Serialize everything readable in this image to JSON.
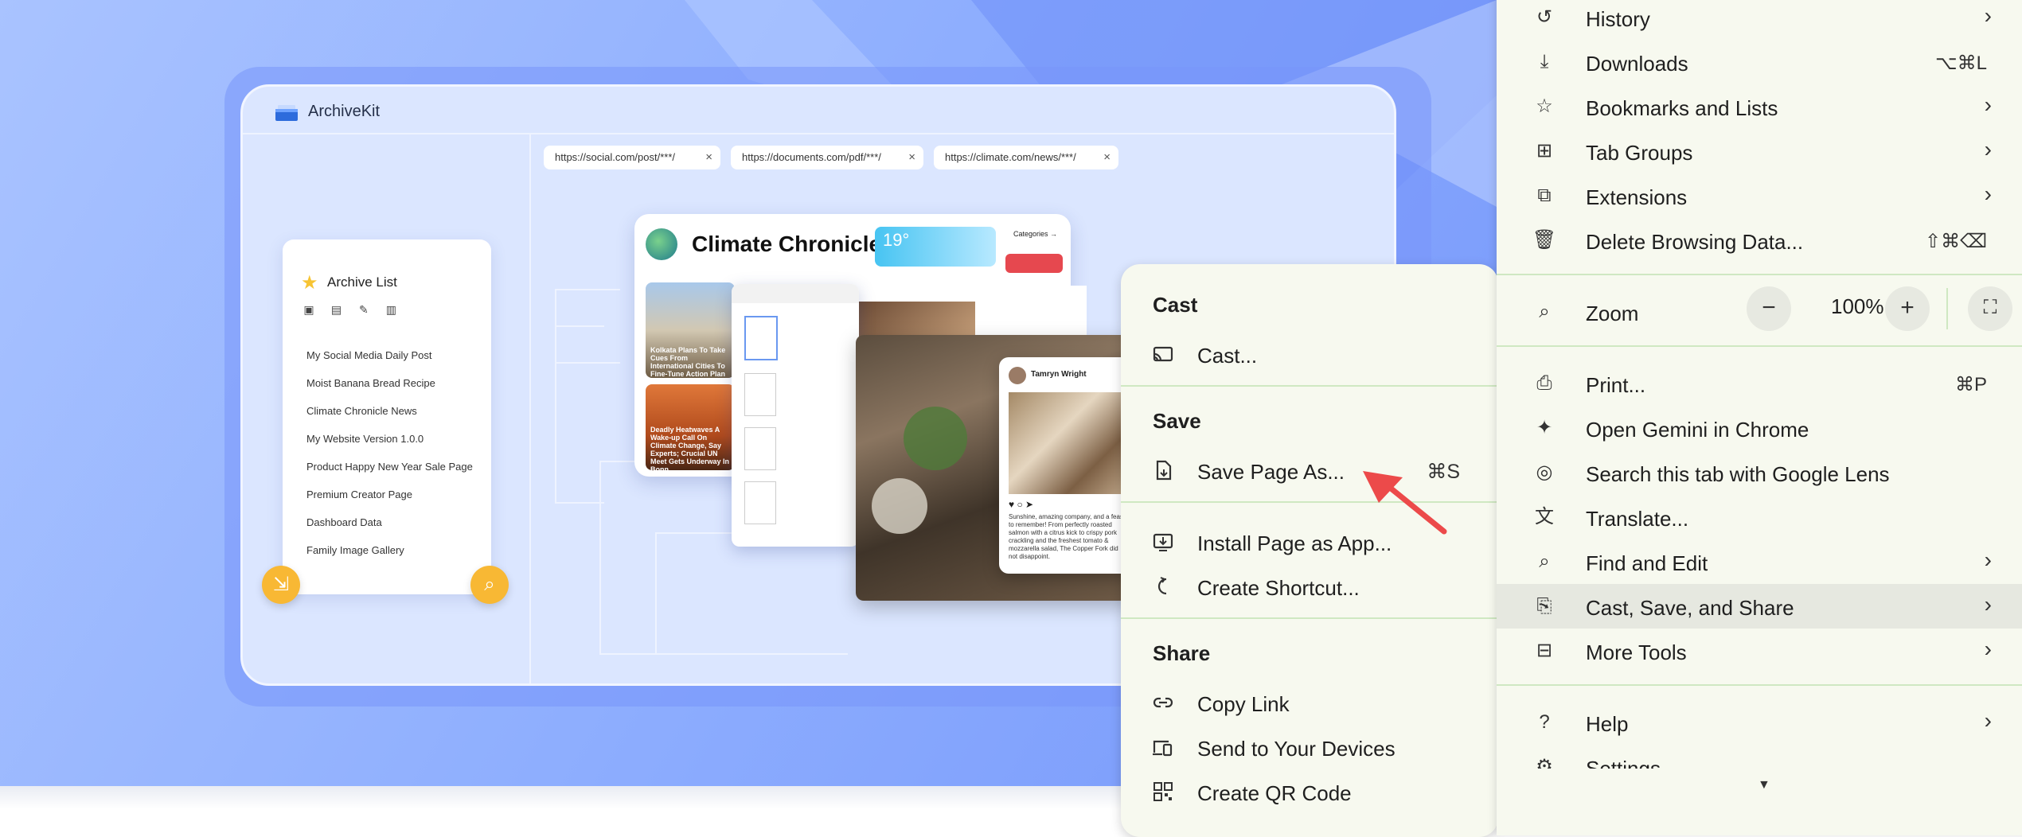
{
  "promo": {
    "app_name": "ArchiveKit",
    "tabs": [
      {
        "url": "https://social.com/post/***/",
        "close": "×"
      },
      {
        "url": "https://documents.com/pdf/***/",
        "close": "×"
      },
      {
        "url": "https://climate.com/news/***/",
        "close": "×"
      }
    ],
    "archive": {
      "title": "Archive List",
      "items": [
        "My Social Media Daily Post",
        "Moist Banana Bread Recipe",
        "Climate Chronicle News",
        "My Website Version 1.0.0",
        "Product Happy New Year Sale Page",
        "Premium Creator Page",
        "Dashboard Data",
        "Family Image Gallery"
      ]
    },
    "climate": {
      "title": "Climate Chronicle",
      "temp": "19°",
      "categories": "Categories →",
      "caption1": "Kolkata Plans To Take Cues From International Cities To Fine-Tune Action Plan And Fight Warm-Up",
      "caption2": "Deadly Heatwaves A Wake-up Call On Climate Change, Say Experts; Crucial UN Meet Gets Underway In Bonn"
    },
    "post": {
      "author": "Tamryn Wright",
      "text": "Sunshine, amazing company, and a feast to remember! From perfectly roasted salmon with a citrus kick to crispy pork crackling and the freshest tomato & mozzarella salad, The Copper Fork did not disappoint."
    }
  },
  "submenu": {
    "sections": {
      "cast": "Cast",
      "save": "Save",
      "share": "Share"
    },
    "items": {
      "cast": {
        "icon": "cast-icon",
        "label": "Cast..."
      },
      "save_page_as": {
        "icon": "save-page-icon",
        "label": "Save Page As...",
        "shortcut": "⌘S"
      },
      "install_app": {
        "icon": "install-app-icon",
        "label": "Install Page as App..."
      },
      "create_shortcut": {
        "icon": "create-shortcut-icon",
        "label": "Create Shortcut..."
      },
      "copy_link": {
        "icon": "link-icon",
        "label": "Copy Link"
      },
      "send_devices": {
        "icon": "send-devices-icon",
        "label": "Send to Your Devices"
      },
      "qr_code": {
        "icon": "qr-code-icon",
        "label": "Create QR Code"
      }
    }
  },
  "mainmenu": {
    "items": {
      "history": {
        "label": "History"
      },
      "downloads": {
        "label": "Downloads",
        "shortcut": "⌥⌘L"
      },
      "bookmarks": {
        "label": "Bookmarks and Lists"
      },
      "tab_groups": {
        "label": "Tab Groups"
      },
      "extensions": {
        "label": "Extensions"
      },
      "delete_data": {
        "label": "Delete Browsing Data...",
        "shortcut": "⇧⌘⌫"
      },
      "zoom": {
        "label": "Zoom",
        "value": "100%",
        "minus": "−",
        "plus": "+"
      },
      "print": {
        "label": "Print...",
        "shortcut": "⌘P"
      },
      "gemini": {
        "label": "Open Gemini in Chrome"
      },
      "lens": {
        "label": "Search this tab with Google Lens"
      },
      "translate": {
        "label": "Translate..."
      },
      "find_edit": {
        "label": "Find and Edit"
      },
      "cast_save_share": {
        "label": "Cast, Save, and Share"
      },
      "more_tools": {
        "label": "More Tools"
      },
      "help": {
        "label": "Help"
      },
      "settings": {
        "label": "Settings"
      }
    }
  },
  "colors": {
    "menu_bg": "#f7f9ef",
    "divider": "#cfe8c2",
    "highlight": "#e6e8e0",
    "arrow": "#ec4a4a",
    "background": "#8eaefe"
  }
}
